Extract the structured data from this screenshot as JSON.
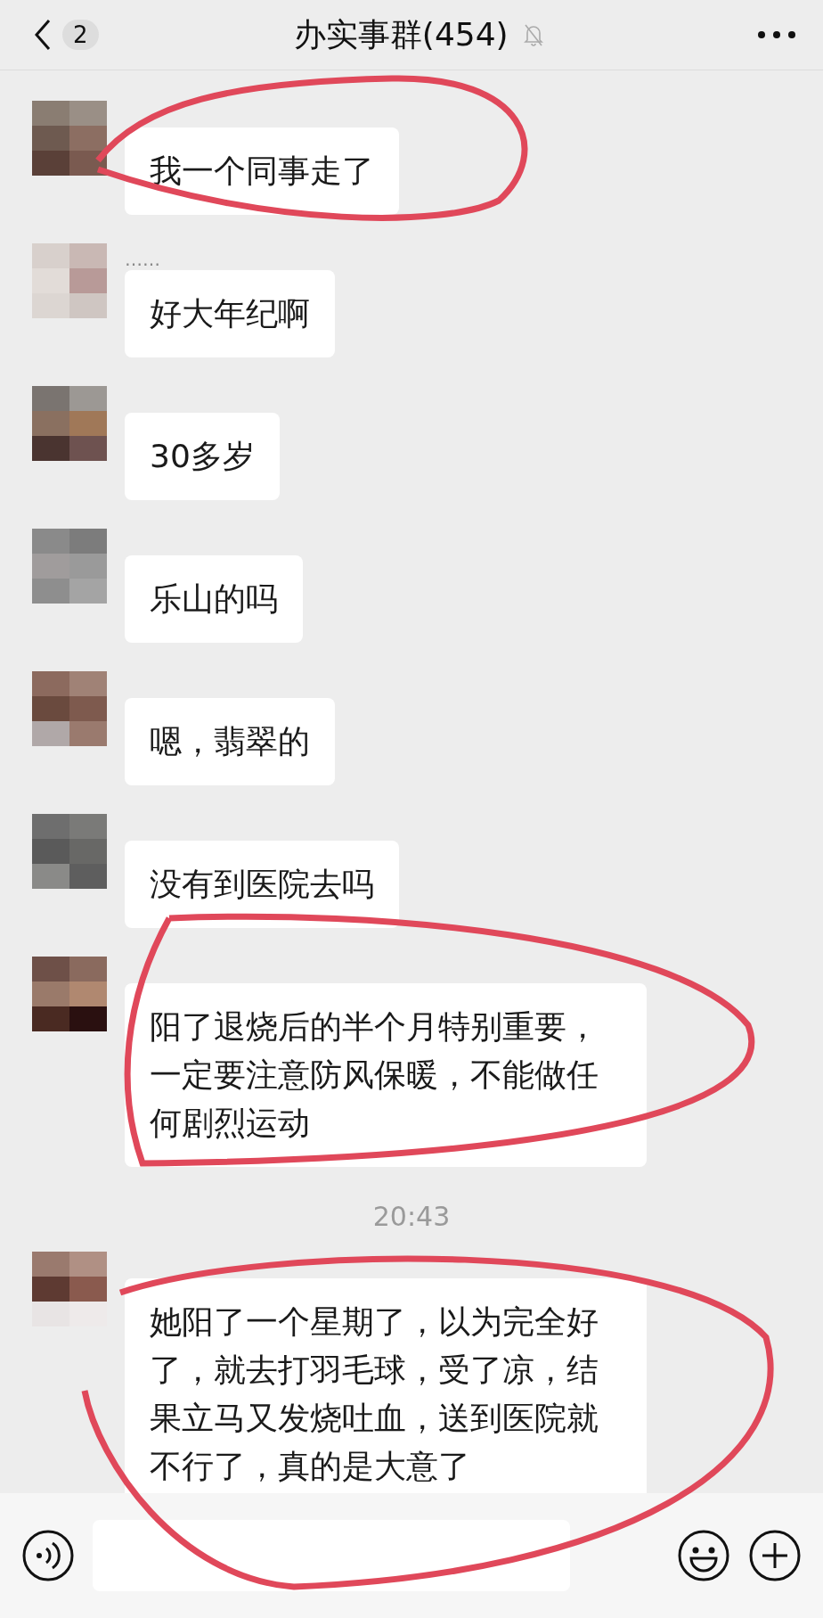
{
  "header": {
    "unread_count": "2",
    "title": "办实事群(454)",
    "muted": true
  },
  "messages": [
    {
      "kind": "text",
      "text": "我一个同事走了"
    },
    {
      "kind": "text",
      "sender": "……",
      "text": "好大年纪啊"
    },
    {
      "kind": "text",
      "text": "30多岁"
    },
    {
      "kind": "text",
      "text": "乐山的吗"
    },
    {
      "kind": "text",
      "text": "嗯，翡翠的"
    },
    {
      "kind": "text",
      "text": "没有到医院去吗"
    },
    {
      "kind": "text",
      "text": "阳了退烧后的半个月特别重要，一定要注意防风保暖，不能做任何剧烈运动"
    },
    {
      "kind": "time",
      "text": "20:43"
    },
    {
      "kind": "text",
      "text": "她阳了一个星期了，以为完全好了，就去打羽毛球，受了凉，结果立马又发烧吐血，送到医院就不行了，真的是大意了"
    }
  ]
}
